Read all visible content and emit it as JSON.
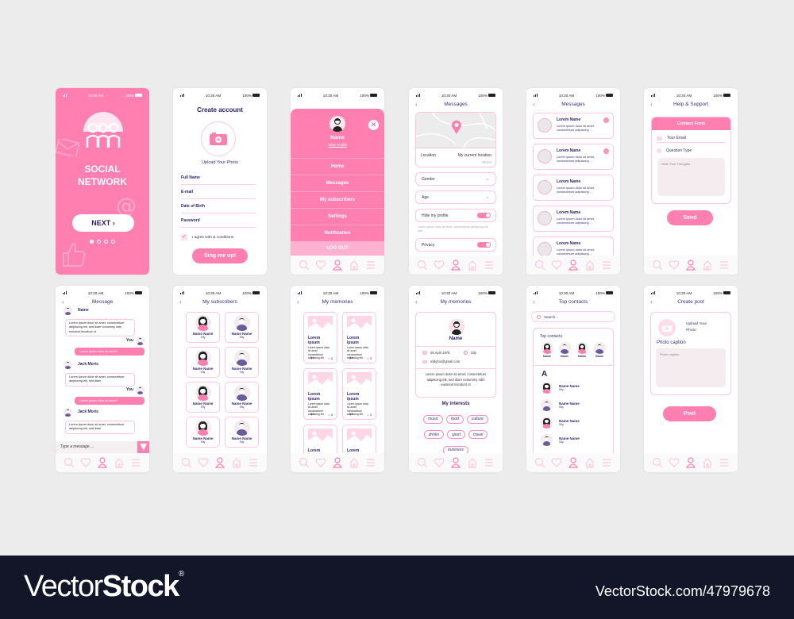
{
  "status": {
    "time": "10:30 AM",
    "battery": "100%"
  },
  "colors": {
    "accent": "#ff7fb0",
    "dark": "#3b2f7a",
    "border": "#ffc7dc",
    "bg": "#ececec"
  },
  "nav_icons": [
    "search-icon",
    "heart-icon",
    "profile-icon",
    "home-icon",
    "menu-icon"
  ],
  "splash": {
    "title_line1": "SOCIAL",
    "title_line2": "NETWORK",
    "next": "NEXT",
    "page_dots": 4,
    "active_dot": 1
  },
  "register": {
    "title": "Create account",
    "upload": "Upload Your Photo",
    "fields": [
      "Full Name",
      "E-mail",
      "Date of Birth",
      "Password"
    ],
    "agree": "I agree with & conditions",
    "submit": "Sing me up!"
  },
  "menu": {
    "name": "Name",
    "view_profile": "View Profile",
    "items": [
      "Home",
      "Messages",
      "My subscribers",
      "Settings",
      "Notification"
    ],
    "logout": "LOG OUT"
  },
  "settings": {
    "title": "Messages",
    "location_label": "Location",
    "location_value": "My current location",
    "street": "Street",
    "gender": "Gender",
    "age": "Age",
    "hide_profile": "Hide my profile",
    "note": "Lorem ipsum dolor sit amet, consectetuer adipiscing elit, sed",
    "privacy": "Privacy"
  },
  "messages": {
    "title": "Messages",
    "items": [
      {
        "name": "Lorem Name",
        "text": "Lorem ipsum dolor sit amet, consectetuer adipiscing ...",
        "badge": "1"
      },
      {
        "name": "Lorem Name",
        "text": "Lorem ipsum dolor sit amet, consectetuer adipiscing ...",
        "badge": "2"
      },
      {
        "name": "Lorem Name",
        "text": "Lorem ipsum dolor sit amet, consectetuer adipiscing ...",
        "badge": ""
      },
      {
        "name": "Lorem Name",
        "text": "Lorem ipsum dolor sit amet, consectetuer adipiscing ...",
        "badge": ""
      },
      {
        "name": "Lorem Name",
        "text": "Lorem ipsum dolor sit amet, consectetuer adipiscing ...",
        "badge": ""
      }
    ]
  },
  "support": {
    "title": "Help & Support",
    "form_title": "Contact Form",
    "email": "Your Email",
    "question": "Question Type",
    "thoughts": "Write Your Thoughts",
    "send": "Send"
  },
  "chat": {
    "title": "Message",
    "messages": [
      {
        "from": "Name",
        "text": "Lorem ipsum dolor sit amet, consectetuer adipiscing elit, sed diam nonummy nibh euismod tincidunt ut",
        "mine": false
      },
      {
        "from": "You",
        "text": "Lorem ipsum dolor sit amet?",
        "mine": true
      },
      {
        "from": "Jack Moris",
        "text": "Lorem ipsum dolor sit amet, consectetuer adipiscing elit, sed diam",
        "mine": false
      },
      {
        "from": "You",
        "text": "Lorem ipsum dolor sit amet?",
        "mine": true
      },
      {
        "from": "Jack Moris",
        "text": "Lorem ipsum dolor sit amet, consectetuer adipiscing elit, sed diam",
        "mine": false
      }
    ],
    "input_placeholder": "Type a message ..."
  },
  "subscribers": {
    "title": "My subscribers",
    "items": [
      {
        "name": "Name Name",
        "city": "Sity",
        "gender": "f"
      },
      {
        "name": "Name Name",
        "city": "Sity",
        "gender": "m"
      },
      {
        "name": "Name Name",
        "city": "Sity",
        "gender": "f"
      },
      {
        "name": "Name Name",
        "city": "Sity",
        "gender": "m"
      },
      {
        "name": "Name Name",
        "city": "Sity",
        "gender": "f"
      },
      {
        "name": "Name Name",
        "city": "Sity",
        "gender": "m"
      },
      {
        "name": "Name Name",
        "city": "Sity",
        "gender": "f"
      },
      {
        "name": "Name Name",
        "city": "Sity",
        "gender": "m"
      }
    ]
  },
  "memories": {
    "title": "My memories",
    "items": [
      {
        "title": "Lorem ipsum",
        "text": "Lorem ipsum dolor sit amet, consectetuer adipiscing elit",
        "likes": "14",
        "comments": "3"
      },
      {
        "title": "Lorem ipsum",
        "text": "Lorem ipsum dolor sit amet, consectetuer adipiscing elit",
        "likes": "14",
        "comments": "3"
      },
      {
        "title": "Lorem ipsum",
        "text": "Lorem ipsum dolor sit amet, consectetuer adipiscing elit",
        "likes": "14",
        "comments": "3"
      },
      {
        "title": "Lorem ipsum",
        "text": "Lorem ipsum dolor sit amet, consectetuer adipiscing elit",
        "likes": "14",
        "comments": "3"
      },
      {
        "title": "Lorem ipsum",
        "text": "",
        "likes": "",
        "comments": ""
      },
      {
        "title": "Lorem ipsum",
        "text": "",
        "likes": "",
        "comments": ""
      }
    ]
  },
  "profile": {
    "title": "My memories",
    "name": "Name",
    "dob": "05 April 1978",
    "city": "Sity",
    "email": "millyfox@gmail.com",
    "bio": "Lorem ipsum dolor sit amet, consectetuer adipiscing elit, sed diam nonummy nibh euismod tincidunt ut",
    "interests_title": "My interests",
    "interests": [
      "music",
      "food",
      "culture",
      "drinks",
      "sport",
      "travel",
      "business"
    ]
  },
  "contacts": {
    "title": "Top contacts",
    "search_placeholder": "Search...",
    "top_label": "Top contacts",
    "top": [
      {
        "name": "Name",
        "g": "f"
      },
      {
        "name": "Name",
        "g": "m"
      },
      {
        "name": "Name",
        "g": "f"
      },
      {
        "name": "Name",
        "g": "m"
      }
    ],
    "letter": "A",
    "list": [
      {
        "name": "Name Name",
        "city": "Sity",
        "g": "f"
      },
      {
        "name": "Name Name",
        "city": "Sity",
        "g": "m"
      },
      {
        "name": "Name Name",
        "city": "Sity",
        "g": "f"
      },
      {
        "name": "Name Name",
        "city": "Sity",
        "g": "m"
      }
    ]
  },
  "post": {
    "title": "Create post",
    "upload": "Upload Your Photo",
    "caption_label": "Photo caption",
    "caption_placeholder": "Photo caption",
    "submit": "Post"
  },
  "footer": {
    "brand_light": "Vector",
    "brand_bold": "Stock",
    "reg": "®",
    "url": "VectorStock.com/47979678"
  }
}
